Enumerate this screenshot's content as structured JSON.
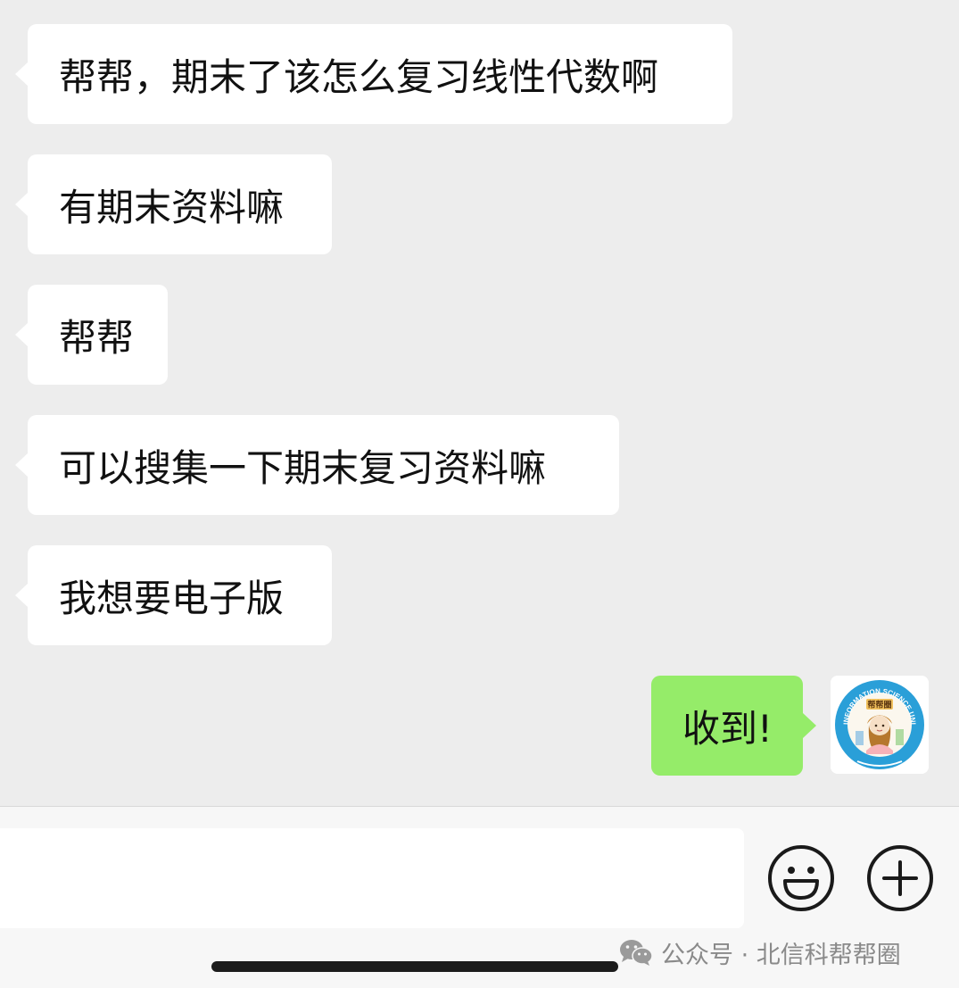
{
  "messages": [
    {
      "side": "incoming",
      "text": "帮帮，期末了该怎么复习线性代数啊"
    },
    {
      "side": "incoming",
      "text": "有期末资料嘛"
    },
    {
      "side": "incoming",
      "text": "帮帮"
    },
    {
      "side": "incoming",
      "text": "可以搜集一下期末复习资料嘛"
    },
    {
      "side": "incoming",
      "text": "我想要电子版"
    },
    {
      "side": "outgoing",
      "text": "收到!"
    }
  ],
  "avatar": {
    "badge": "帮帮圈",
    "ring_text": "BEIJING INFORMATION SCIENCE UNIVERSITY"
  },
  "input": {
    "value": "",
    "placeholder": ""
  },
  "toolbar": {
    "emoji_icon": "smiley-face-icon",
    "plus_icon": "plus-circle-icon"
  },
  "watermark": {
    "text": "公众号 · 北信科帮帮圈",
    "icon": "wechat-icon"
  },
  "colors": {
    "background": "#ededed",
    "incoming_bubble": "#ffffff",
    "outgoing_bubble": "#95ec69",
    "text": "#111111",
    "watermark_text": "#8a8a8a",
    "avatar_ring": "#2a9fd8"
  }
}
